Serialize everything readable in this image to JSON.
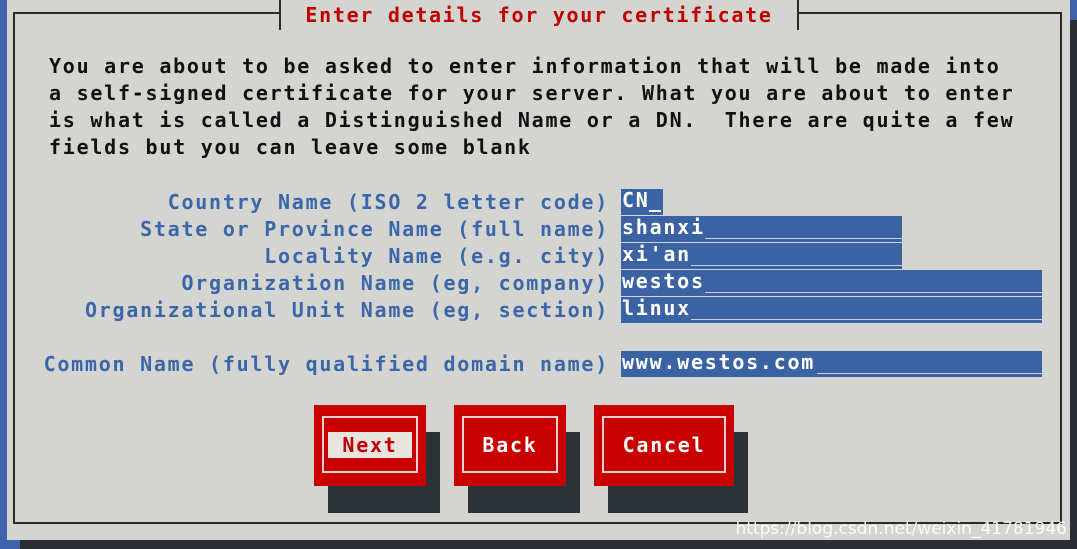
{
  "dialog": {
    "title": "Enter details for your certificate",
    "intro_lines": [
      "You are about to be asked to enter information that will be made into",
      "a self-signed certificate for your server. What you are about to enter",
      "is what is called a Distinguished Name or a DN.  There are quite a few",
      "fields but you can leave some blank"
    ]
  },
  "fields": {
    "country": {
      "label": "Country Name (ISO 2 letter code)",
      "value": "CN"
    },
    "state": {
      "label": "State or Province Name (full name)",
      "value": "shanxi"
    },
    "locality": {
      "label": "Locality Name (e.g. city)",
      "value": "xi'an"
    },
    "organization": {
      "label": "Organization Name (eg, company)",
      "value": "westos"
    },
    "unit": {
      "label": "Organizational Unit Name (eg, section)",
      "value": "linux"
    },
    "common_name": {
      "label": "Common Name (fully qualified domain name)",
      "value": "www.westos.com"
    }
  },
  "buttons": {
    "next": "Next",
    "back": "Back",
    "cancel": "Cancel"
  },
  "watermark": "https://blog.csdn.net/weixin_41781946",
  "colors": {
    "background": "#3f62a8",
    "dialog": "#d4d5d0",
    "title_text": "#c00000",
    "label_text": "#3b66a9",
    "input_bg": "#3b63a4",
    "button_bg": "#c90000"
  }
}
